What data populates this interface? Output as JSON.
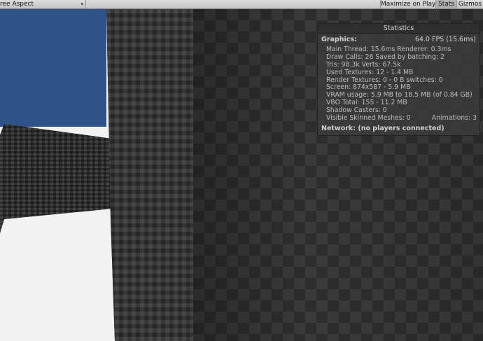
{
  "toolbar": {
    "aspect_label": "ree Aspect",
    "aspect_caret": "▾",
    "maximize_label": "Maximize on Play",
    "stats_label": "Stats",
    "gizmos_label": "Gizmos"
  },
  "stats": {
    "title": "Statistics",
    "graphics_label": "Graphics:",
    "fps": "64.0 FPS (15.6ms)",
    "lines": [
      "Main Thread: 15.6ms  Renderer: 0.3ms",
      "Draw Calls: 26     Saved by batching: 2",
      "Tris: 98.3k   Verts: 67.5k",
      "Used Textures: 12 - 1.4 MB",
      "Render Textures: 0 - 0 B  switches: 0",
      "Screen: 874x587 - 5.9 MB",
      "VRAM usage: 5.9 MB to 18.5 MB (of 0.84 GB)",
      "VBO Total: 155 - 11.2 MB",
      "Shadow Casters: 0"
    ],
    "skinned_label": "Visible Skinned Meshes: 0",
    "animations_label": "Animations: 3",
    "network_label": "Network: (no players connected)"
  },
  "colors": {
    "sky": "#2f5289",
    "ground": "#f2f2f2",
    "panel": "#3c3c3c"
  }
}
